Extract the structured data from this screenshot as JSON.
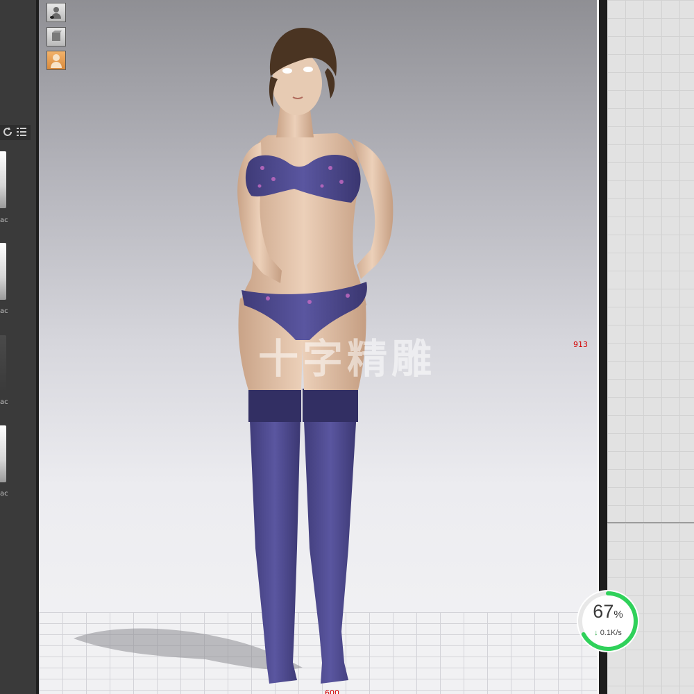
{
  "left_panel": {
    "thumbnails": [
      {
        "label": "ac"
      },
      {
        "label": "ac"
      },
      {
        "label": "ac"
      },
      {
        "label": "ac"
      }
    ],
    "toolbar": {
      "refresh_icon": "refresh-icon",
      "list_icon": "list-view-icon"
    }
  },
  "viewport": {
    "tools": [
      {
        "icon": "user-view-icon"
      },
      {
        "icon": "surface-icon"
      },
      {
        "icon": "figure-select-icon",
        "active": true
      }
    ],
    "measure_height": "913",
    "measure_width": "600",
    "watermark": "十字精雕"
  },
  "progress": {
    "value": 67,
    "percent_text": "67",
    "percent_sign": "%",
    "speed": "0.1K/s",
    "ring_color": "#2fd15a"
  }
}
